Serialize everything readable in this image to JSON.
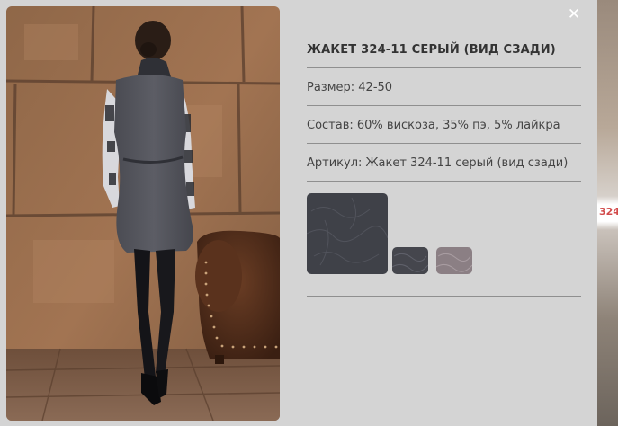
{
  "background": {
    "product_code": "324-"
  },
  "close_icon": "close-icon",
  "product": {
    "title": "ЖАКЕТ 324-11 СЕРЫЙ (ВИД СЗАДИ)",
    "size": "Размер: 42-50",
    "composition": "Состав: 60% вискоза, 35% пэ, 5% лайкра",
    "article": "Артикул: Жакет 324-11 серый (вид сзади)"
  },
  "swatches": [
    {
      "name": "swatch-large-gray",
      "color": "#3f4148"
    },
    {
      "name": "swatch-dark-gray",
      "color": "#45464d"
    },
    {
      "name": "swatch-mauve",
      "color": "#8b7f84"
    }
  ]
}
